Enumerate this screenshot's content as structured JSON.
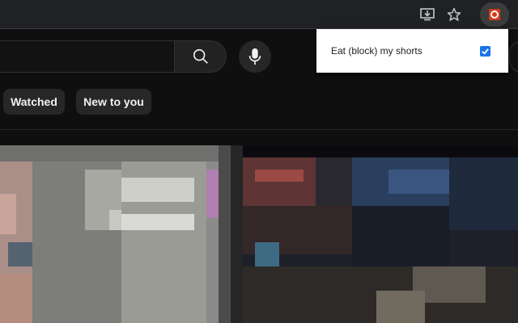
{
  "toolbar": {
    "install_icon": "install-app-icon",
    "star_icon": "bookmark-star-icon",
    "extension_icon": "extension-shorts-blocker-icon"
  },
  "search": {
    "placeholder": "",
    "search_icon": "search-icon",
    "mic_icon": "microphone-icon"
  },
  "chips": [
    {
      "label": "Watched"
    },
    {
      "label": "New to you"
    }
  ],
  "popup": {
    "label": "Eat (block) my shorts",
    "checked": true
  },
  "colors": {
    "accent": "#1a73e8",
    "extension_brand": "#d23a1b"
  }
}
